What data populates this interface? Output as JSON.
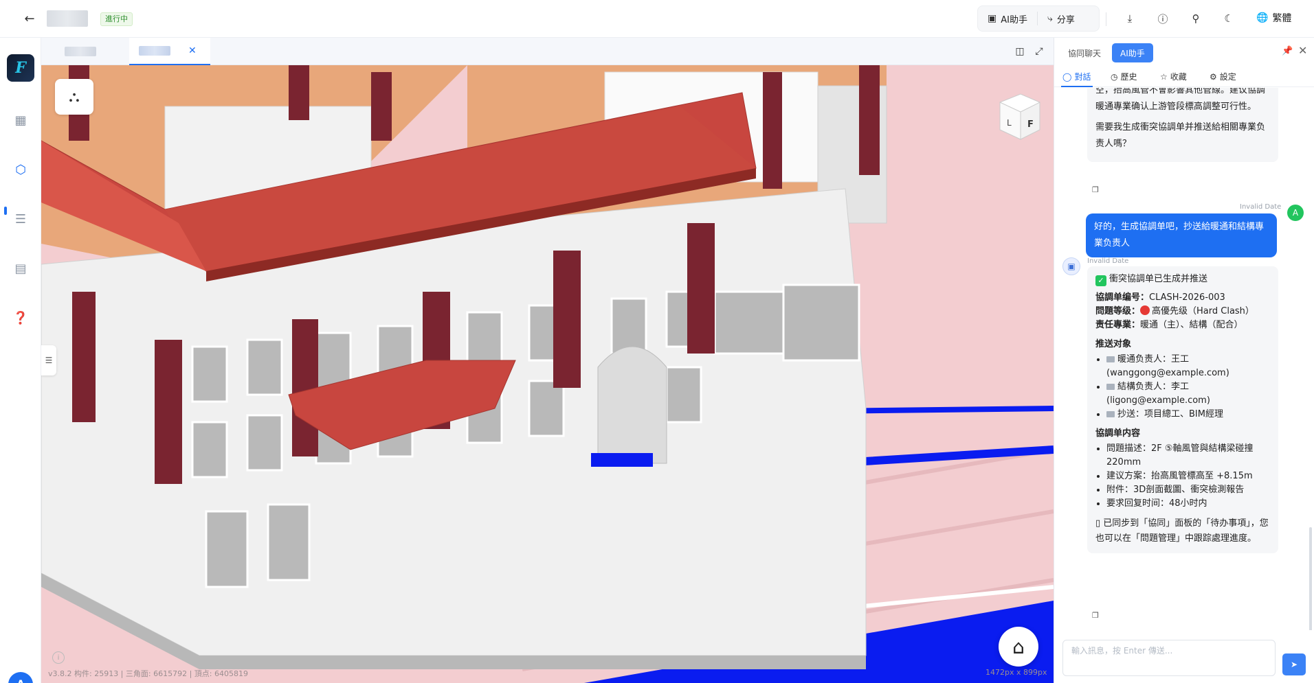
{
  "header": {
    "status": "進行中",
    "ai_button": "AI助手",
    "share_button": "分享",
    "language": "繁體"
  },
  "panel": {
    "tab_chat": "協同聊天",
    "tab_ai": "AI助手",
    "subtabs": [
      "對話",
      "歷史",
      "收藏",
      "設定"
    ]
  },
  "messages": {
    "ai1": {
      "line1": "空，抬高風管不會影響其他管線。建议協調暖通專業确认上游管段標高調整可行性。",
      "line2": "需要我生成衝突協調单并推送給相關專業负责人嗎？"
    },
    "user": {
      "time": "Invalid Date",
      "avatar": "A",
      "text": "好的，生成協調单吧，抄送給暖通和結構專業负责人"
    },
    "ai2": {
      "time": "Invalid Date",
      "title": "衝突協調单已生成并推送",
      "id_label": "協調单编号：",
      "id_value": "CLASH-2026-003",
      "level_label": "問題等级：",
      "level_value": "高優先级（Hard Clash）",
      "dept_label": "责任專業：",
      "dept_value": "暖通（主）、結構（配合）",
      "push_title": "推送对象",
      "push_items": [
        "暖通负责人：王工 (wanggong@example.com)",
        "結構负责人：李工 (ligong@example.com)",
        "抄送：项目總工、BIM經理"
      ],
      "content_title": "協調单内容",
      "content_items": [
        "問題描述：2F ⑤軸風管與結構梁碰撞 220mm",
        "建议方案：抬高風管標高至 +8.15m",
        "附件：3D剖面截圖、衝突檢測報告",
        "要求回复时间：48小时内"
      ],
      "footer": "已同步到「協同」面板的「待办事項」，您也可以在「問題管理」中跟踪處理進度。"
    }
  },
  "input": {
    "placeholder": "輸入訊息，按 Enter 傳送..."
  },
  "viewer": {
    "stats": "v3.8.2   构件: 25913 | 三角面: 6615792 | 頂点: 6405819",
    "resolution": "1472px x 899px",
    "cube_left": "L",
    "cube_front": "F"
  },
  "user_avatar": "A",
  "colors": {
    "accent": "#1e6ff2",
    "roof": "#c8463f",
    "floor": "#f3cdd0",
    "duct": "#0a1cf0"
  }
}
